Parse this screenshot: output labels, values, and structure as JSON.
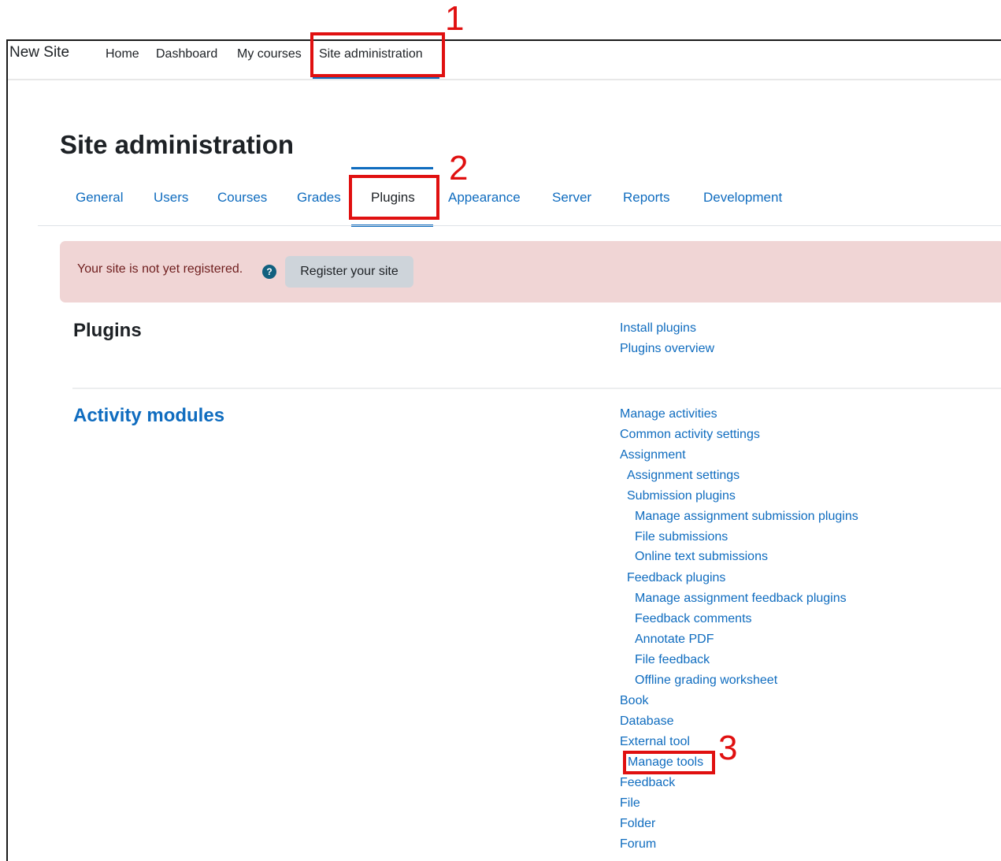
{
  "navbar": {
    "brand": "New Site",
    "items": [
      "Home",
      "Dashboard",
      "My courses",
      "Site administration"
    ]
  },
  "page": {
    "title": "Site administration",
    "tabs": [
      "General",
      "Users",
      "Courses",
      "Grades",
      "Plugins",
      "Appearance",
      "Server",
      "Reports",
      "Development"
    ],
    "active_tab": "Plugins"
  },
  "alert": {
    "text": "Your site is not yet registered.",
    "help_glyph": "?",
    "button": "Register your site"
  },
  "plugins_section": {
    "heading": "Plugins",
    "links": [
      "Install plugins",
      "Plugins overview"
    ]
  },
  "activity_section": {
    "heading": "Activity modules",
    "links": [
      "Manage activities",
      "Common activity settings",
      "Assignment",
      "Assignment settings",
      "Submission plugins",
      "Manage assignment submission plugins",
      "File submissions",
      "Online text submissions",
      "Feedback plugins",
      "Manage assignment feedback plugins",
      "Feedback comments",
      "Annotate PDF",
      "File feedback",
      "Offline grading worksheet",
      "Book",
      "Database",
      "External tool",
      "Manage tools",
      "Feedback",
      "File",
      "Folder",
      "Forum"
    ]
  },
  "callouts": [
    "1",
    "2",
    "3"
  ],
  "colors": {
    "link": "#0f6cbf",
    "text": "#1d2125",
    "alert_bg": "#f0d5d5",
    "alert_text": "#6e1d1d",
    "callout": "#e01010"
  }
}
